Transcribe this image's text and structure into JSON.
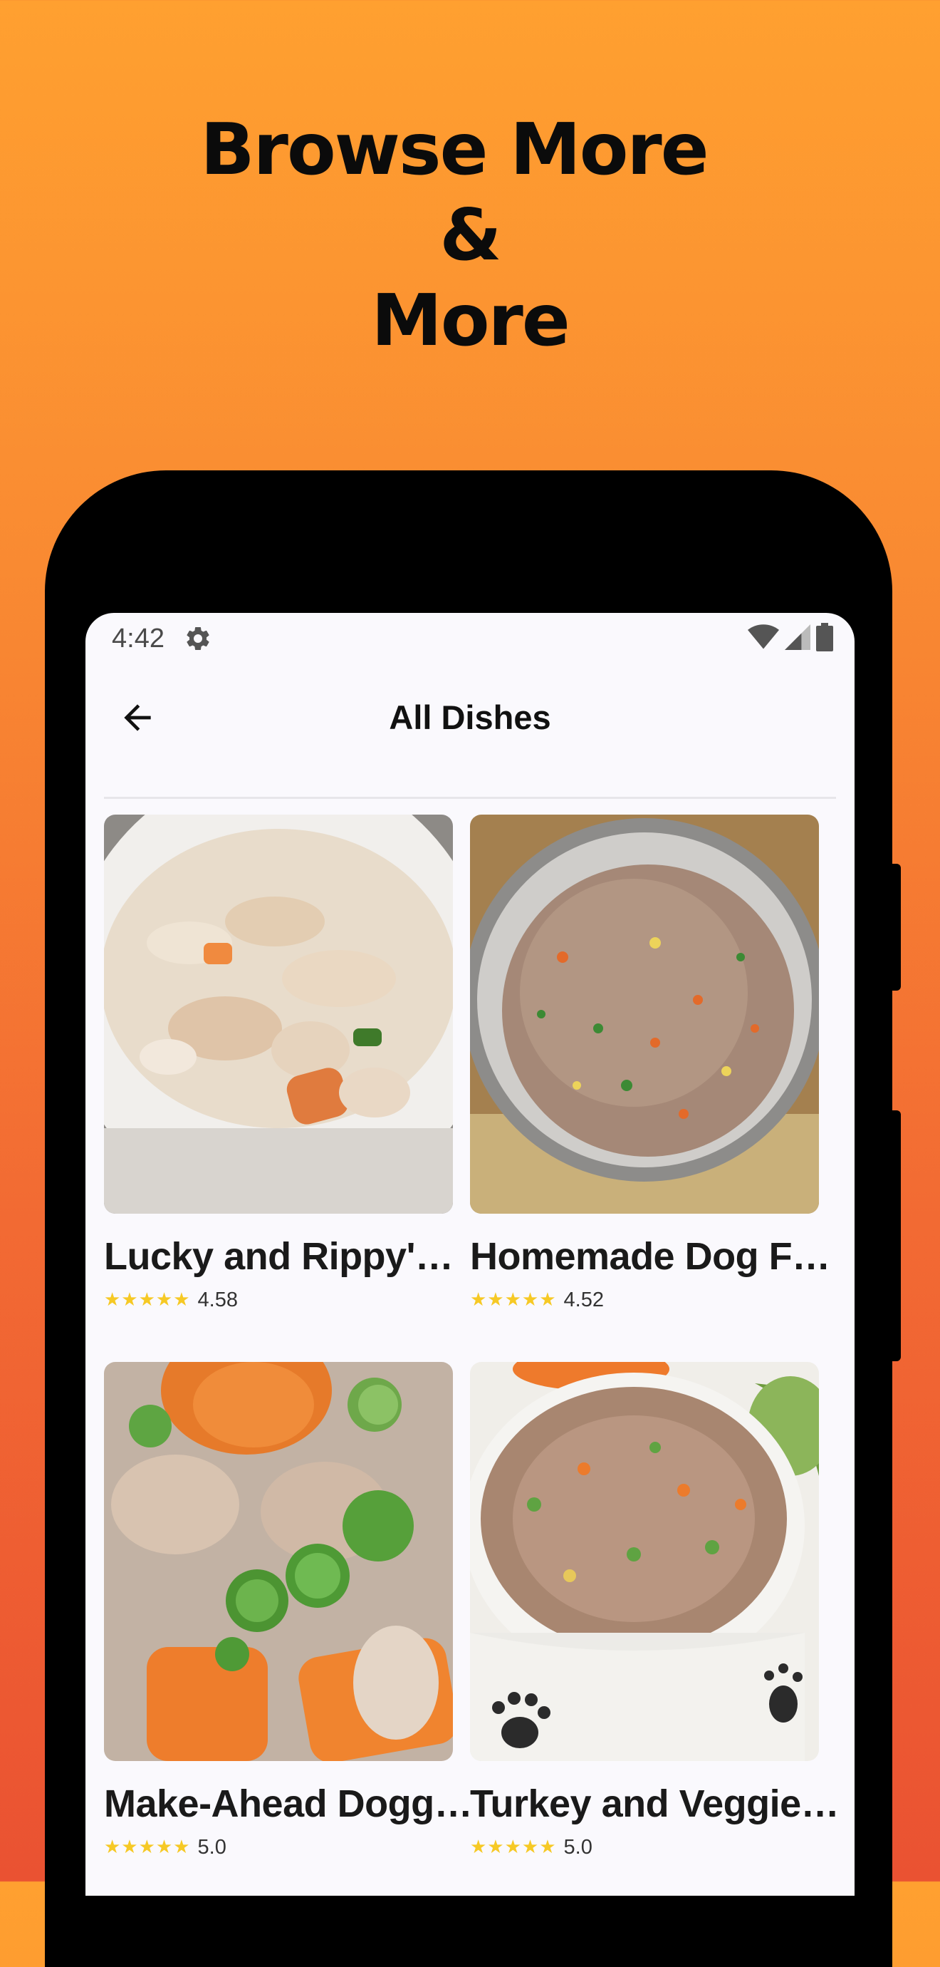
{
  "promo": {
    "headline_line1": "Browse More",
    "headline_line2": "&",
    "headline_line3": "More"
  },
  "status_bar": {
    "time": "4:42",
    "icons": [
      "gear-icon",
      "wifi-icon",
      "cell-signal-icon",
      "battery-icon"
    ]
  },
  "app_bar": {
    "back_icon": "arrow-left-icon",
    "title": "All Dishes"
  },
  "dishes": [
    {
      "title": "Lucky and Rippy's ...",
      "stars": "★★★★★",
      "rating": "4.58",
      "image": "chicken-rice-bowl"
    },
    {
      "title": "Homemade Dog Food",
      "stars": "★★★★★",
      "rating": "4.52",
      "image": "metal-bowl-rice-mix"
    },
    {
      "title": "Make-Ahead Doggi...",
      "stars": "★★★★★",
      "rating": "5.0",
      "image": "carrots-peas-chicken"
    },
    {
      "title": "Turkey and Veggie ...",
      "stars": "★★★★★",
      "rating": "5.0",
      "image": "paw-print-bowl"
    }
  ],
  "colors": {
    "background_top": "#FFA030",
    "background_bottom": "#EA5232",
    "star": "#F6C925",
    "screen_bg": "#FAF9FD"
  }
}
